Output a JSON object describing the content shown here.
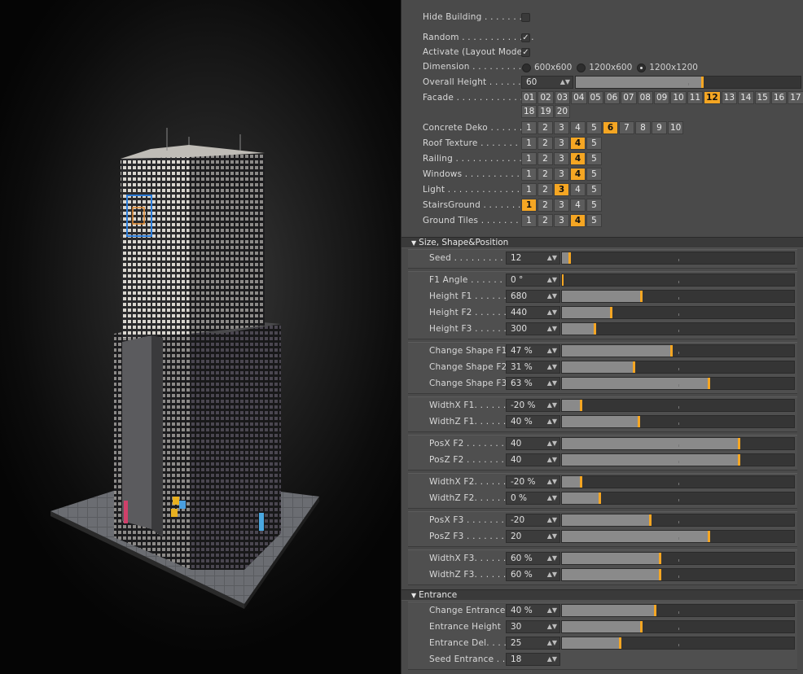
{
  "top_controls": {
    "hide_building": {
      "label": "Hide Building . . . . . . . .",
      "checked": false
    },
    "random": {
      "label": "Random . . . . . . . . . . . . .",
      "checked": true
    },
    "activate": {
      "label": "Activate (Layout Mode)",
      "checked": true
    },
    "dimension": {
      "label": "Dimension . . . . . . . . .",
      "options": [
        "600x600",
        "1200x600",
        "1200x1200"
      ],
      "selected": 2
    },
    "overall_height": {
      "label": "Overall Height . . . . . . .",
      "value": "60",
      "fraction": 0.56
    },
    "facade": {
      "label": "Facade . . . . . . . . . . . . .",
      "options": [
        "01",
        "02",
        "03",
        "04",
        "05",
        "06",
        "07",
        "08",
        "09",
        "10",
        "11",
        "12",
        "13",
        "14",
        "15",
        "16",
        "17",
        "18",
        "19",
        "20"
      ],
      "selected": "12"
    },
    "concrete_deko": {
      "label": "Concrete Deko . . . . . . .",
      "options": [
        "1",
        "2",
        "3",
        "4",
        "5",
        "6",
        "7",
        "8",
        "9",
        "10"
      ],
      "selected": "6"
    },
    "roof_texture": {
      "label": "Roof Texture . . . . . . . .",
      "options": [
        "1",
        "2",
        "3",
        "4",
        "5"
      ],
      "selected": "4"
    },
    "railing": {
      "label": "Railing . . . . . . . . . . . . .",
      "options": [
        "1",
        "2",
        "3",
        "4",
        "5"
      ],
      "selected": "4"
    },
    "windows": {
      "label": "Windows . . . . . . . . . . . .",
      "options": [
        "1",
        "2",
        "3",
        "4",
        "5"
      ],
      "selected": "4"
    },
    "light": {
      "label": "Light . . . . . . . . . . . . . . .",
      "options": [
        "1",
        "2",
        "3",
        "4",
        "5"
      ],
      "selected": "3"
    },
    "stairs_ground": {
      "label": "StairsGround . . . . . . . .",
      "options": [
        "1",
        "2",
        "3",
        "4",
        "5"
      ],
      "selected": "1"
    },
    "ground_tiles": {
      "label": "Ground Tiles . . . . . . . .",
      "options": [
        "1",
        "2",
        "3",
        "4",
        "5"
      ],
      "selected": "4"
    }
  },
  "sections": {
    "size": "Size, Shape&Position",
    "entrance": "Entrance"
  },
  "size_groups": [
    [
      {
        "label": "Seed . . . . . . . . . . . . .",
        "value": "12",
        "fraction": 0.03
      }
    ],
    [
      {
        "label": "F1 Angle . . . . . . . .",
        "value": "0 °",
        "fraction": 0.0
      },
      {
        "label": "Height F1 . . . . . . . .",
        "value": "680",
        "fraction": 0.34
      },
      {
        "label": "Height F2 . . . . . . . .",
        "value": "440",
        "fraction": 0.21
      },
      {
        "label": "Height F3 . . . . . . . .",
        "value": "300",
        "fraction": 0.14
      }
    ],
    [
      {
        "label": "Change Shape F1",
        "value": "47 %",
        "fraction": 0.47
      },
      {
        "label": "Change Shape F2",
        "value": "31 %",
        "fraction": 0.31
      },
      {
        "label": "Change Shape F3",
        "value": "63 %",
        "fraction": 0.63
      }
    ],
    [
      {
        "label": "WidthX F1. . . . . . . .",
        "value": "-20 %",
        "fraction": 0.08
      },
      {
        "label": "WidthZ F1. . . . . . . .",
        "value": "40 %",
        "fraction": 0.33
      }
    ],
    [
      {
        "label": "PosX F2 . . . . . . . . .",
        "value": "40",
        "fraction": 0.76
      },
      {
        "label": "PosZ F2 . . . . . . . . .",
        "value": "40",
        "fraction": 0.76
      }
    ],
    [
      {
        "label": "WidthX F2. . . . . . . .",
        "value": "-20 %",
        "fraction": 0.08
      },
      {
        "label": "WidthZ F2. . . . . . . .",
        "value": "0 %",
        "fraction": 0.16
      }
    ],
    [
      {
        "label": "PosX F3 . . . . . . . . .",
        "value": "-20",
        "fraction": 0.38
      },
      {
        "label": "PosZ F3 . . . . . . . . .",
        "value": "20",
        "fraction": 0.63
      }
    ],
    [
      {
        "label": "WidthX F3. . . . . . . .",
        "value": "60 %",
        "fraction": 0.42
      },
      {
        "label": "WidthZ F3. . . . . . . .",
        "value": "60 %",
        "fraction": 0.42
      }
    ]
  ],
  "entrance_rows": [
    {
      "label": "Change Entrance",
      "value": "40 %",
      "fraction": 0.4
    },
    {
      "label": "Entrance Height",
      "value": "30",
      "fraction": 0.34
    },
    {
      "label": "Entrance Del. . . . . .",
      "value": "25",
      "fraction": 0.25
    },
    {
      "label": "Seed Entrance . . .",
      "value": "18",
      "fraction": null
    }
  ]
}
